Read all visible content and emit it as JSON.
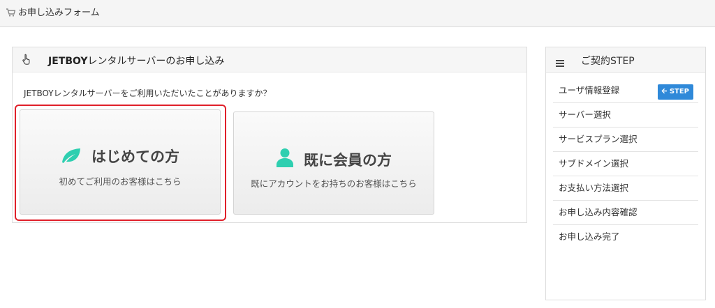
{
  "header": {
    "title": "お申し込みフォーム"
  },
  "main": {
    "title_bold": "JETBOY",
    "title_rest": "レンタルサーバーのお申し込み",
    "question": "JETBOYレンタルサーバーをご利用いただいたことがありますか？",
    "options": [
      {
        "title": "はじめての方",
        "subtitle": "初めてご利用のお客様はこちら"
      },
      {
        "title": "既に会員の方",
        "subtitle": "既にアカウントをお持ちのお客様はこちら"
      }
    ]
  },
  "sidebar": {
    "title": "ご契約STEP",
    "current_badge": "STEP",
    "steps": [
      {
        "label": "ユーザ情報登録"
      },
      {
        "label": "サーバー選択"
      },
      {
        "label": "サービスプラン選択"
      },
      {
        "label": "サブドメイン選択"
      },
      {
        "label": "お支払い方法選択"
      },
      {
        "label": "お申し込み内容確認"
      },
      {
        "label": "お申し込み完了"
      }
    ]
  },
  "colors": {
    "accent": "#2f89d9",
    "highlight": "#e0202a",
    "icon": "#2ecfb0"
  }
}
